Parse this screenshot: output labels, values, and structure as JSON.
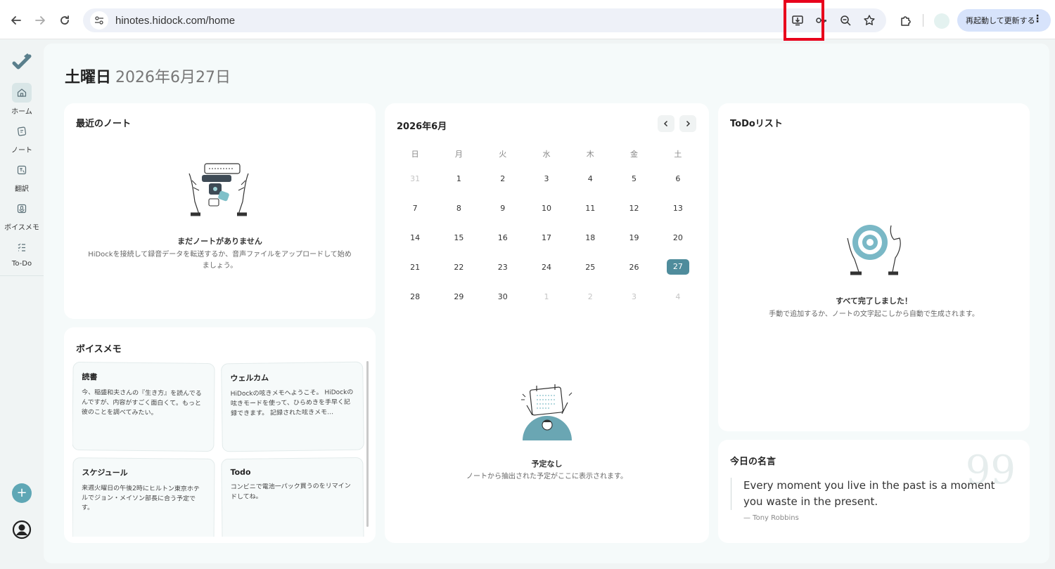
{
  "browser": {
    "url": "hinotes.hidock.com/home",
    "update_button": "再起動して更新する"
  },
  "sidebar": {
    "items": [
      {
        "label": "ホーム",
        "icon": "home-icon"
      },
      {
        "label": "ノート",
        "icon": "note-icon"
      },
      {
        "label": "翻訳",
        "icon": "translate-icon"
      },
      {
        "label": "ボイスメモ",
        "icon": "voice-memo-icon"
      },
      {
        "label": "To-Do",
        "icon": "todo-icon"
      }
    ]
  },
  "header": {
    "weekday": "土曜日",
    "date": "2026年6月27日"
  },
  "recent_notes": {
    "title": "最近のノート",
    "empty_title": "まだノートがありません",
    "empty_desc": "HiDockを接続して録音データを転送するか、音声ファイルをアップロードして始めましょう。"
  },
  "calendar": {
    "month": "2026年6月",
    "weekdays": [
      "日",
      "月",
      "火",
      "水",
      "木",
      "金",
      "土"
    ],
    "weeks": [
      [
        "31",
        "1",
        "2",
        "3",
        "4",
        "5",
        "6"
      ],
      [
        "7",
        "8",
        "9",
        "10",
        "11",
        "12",
        "13"
      ],
      [
        "14",
        "15",
        "16",
        "17",
        "18",
        "19",
        "20"
      ],
      [
        "21",
        "22",
        "23",
        "24",
        "25",
        "26",
        "27"
      ],
      [
        "28",
        "29",
        "30",
        "1",
        "2",
        "3",
        "4"
      ]
    ],
    "empty_title": "予定なし",
    "empty_desc": "ノートから抽出された予定がここに表示されます。"
  },
  "todo": {
    "title": "ToDoリスト",
    "empty_title": "すべて完了しました！",
    "empty_desc": "手動で追加するか、ノートの文字起こしから自動で生成されます。"
  },
  "voice_memos": {
    "title": "ボイスメモ",
    "items": [
      {
        "title": "読書",
        "body": "今、稲盛和夫さんの『生き方』を読んでるんですが、内容がすごく面白くて。もっと彼のことを調べてみたい。"
      },
      {
        "title": "ウェルカム",
        "body": "HiDockの呟きメモへようこそ。 HiDockの呟きモードを使って、ひらめきを手早く記録できます。 記録された呟きメモ…"
      },
      {
        "title": "スケジュール",
        "body": "来週火曜日の午後2時にヒルトン東京ホテルでジョン・メイソン部長に合う予定です。"
      },
      {
        "title": "Todo",
        "body": "コンビニで電池一パック買うのをリマインドしてね。"
      }
    ]
  },
  "quote": {
    "title": "今日の名言",
    "text": "Every moment you live in the past is a moment you waste in the present.",
    "author": "— Tony Robbins",
    "mark": "99"
  },
  "colors": {
    "accent": "#4f8c9c",
    "add_button": "#5fa7b5",
    "highlight": "#e8001c"
  }
}
